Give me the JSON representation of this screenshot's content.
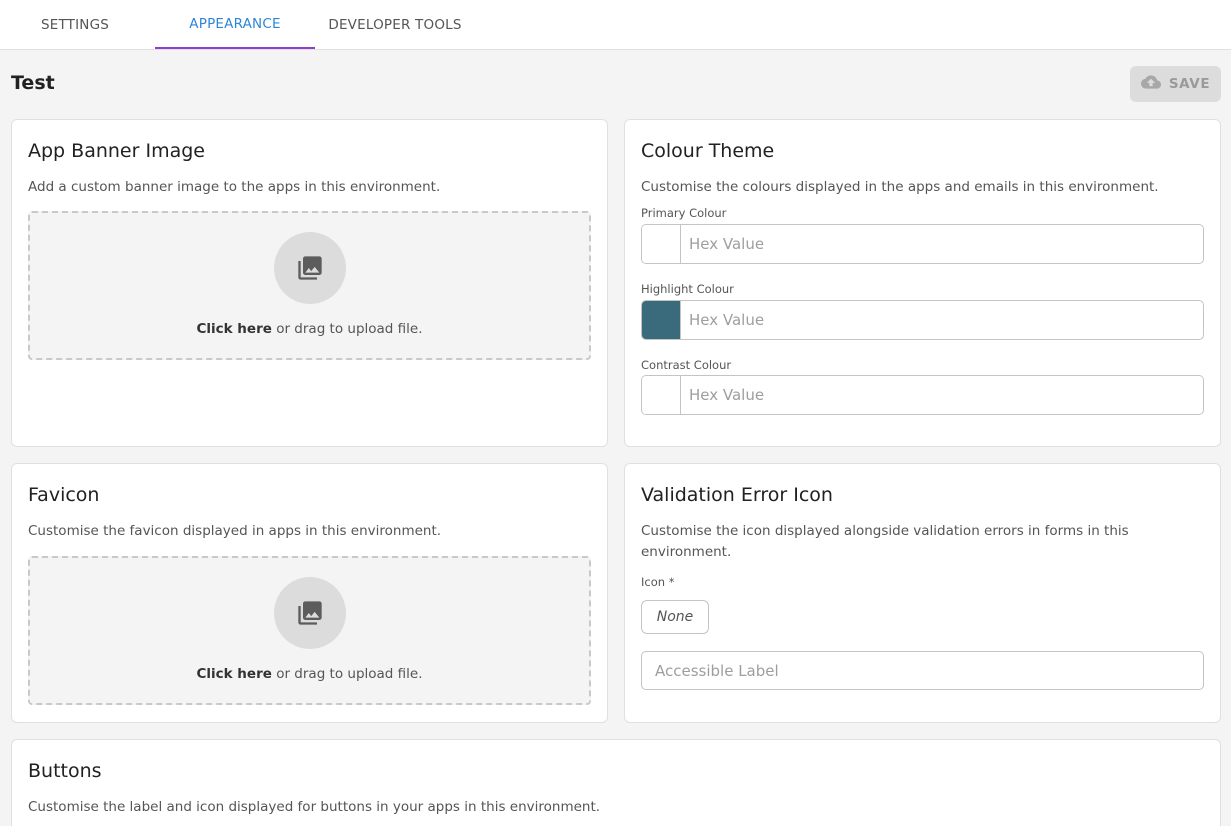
{
  "tabs": [
    {
      "label": "SETTINGS"
    },
    {
      "label": "APPEARANCE"
    },
    {
      "label": "DEVELOPER TOOLS"
    }
  ],
  "page": {
    "title": "Test",
    "save_label": "SAVE",
    "save_icon": "cloud-upload-icon"
  },
  "banner": {
    "title": "App Banner Image",
    "description": "Add a custom banner image to the apps in this environment.",
    "upload_link": "Click here",
    "upload_rest": " or drag to upload file.",
    "icon": "image-icon"
  },
  "favicon": {
    "title": "Favicon",
    "description": "Customise the favicon displayed in apps in this environment.",
    "upload_link": "Click here",
    "upload_rest": " or drag to upload file.",
    "icon": "image-icon"
  },
  "colour_theme": {
    "title": "Colour Theme",
    "description": "Customise the colours displayed in the apps and emails in this environment.",
    "fields": [
      {
        "label": "Primary Colour",
        "placeholder": "Hex Value",
        "value": "",
        "swatch": "#ffffff"
      },
      {
        "label": "Highlight Colour",
        "placeholder": "Hex Value",
        "value": "",
        "swatch": "#3a6b7c"
      },
      {
        "label": "Contrast Colour",
        "placeholder": "Hex Value",
        "value": "",
        "swatch": "#ffffff"
      }
    ]
  },
  "validation": {
    "title": "Validation Error Icon",
    "description": "Customise the icon displayed alongside validation errors in forms in this environment.",
    "icon_label": "Icon *",
    "icon_value": "None",
    "accessible_placeholder": "Accessible Label",
    "accessible_value": ""
  },
  "buttons": {
    "title": "Buttons",
    "description": "Customise the label and icon displayed for buttons in your apps in this environment."
  },
  "colors": {
    "accent": "#2f86d6",
    "tab_indicator": "#8a3fd1",
    "save_disabled_bg": "#dcdcdc"
  }
}
